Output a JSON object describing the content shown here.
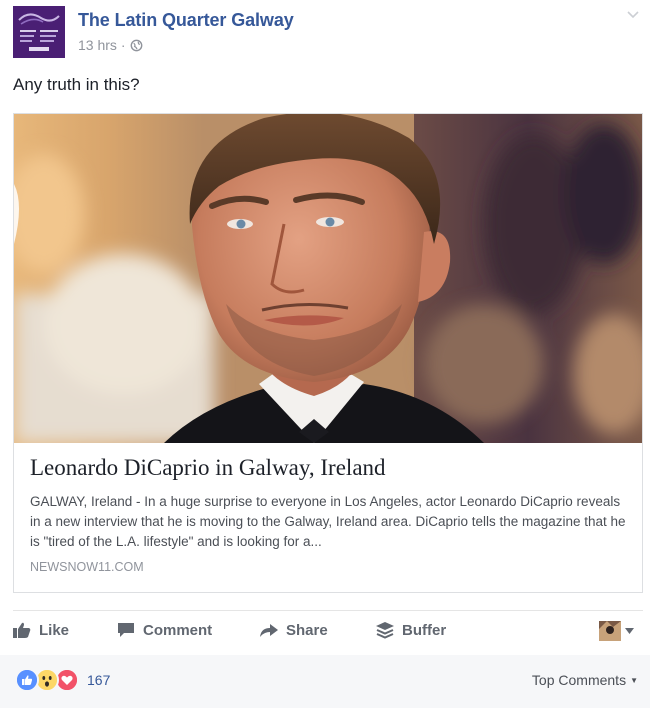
{
  "post": {
    "page_name": "The Latin Quarter Galway",
    "time": "13 hrs",
    "separator": "·",
    "privacy_icon": "globe-icon",
    "message": "Any truth in this?"
  },
  "link": {
    "title": "Leonardo DiCaprio in Galway, Ireland",
    "description": "GALWAY, Ireland - In a huge surprise to everyone in Los Angeles, actor Leonardo DiCaprio reveals in a new interview that he is moving to the Galway, Ireland area. DiCaprio tells the magazine that he is \"tired of the L.A. lifestyle\" and is looking for a...",
    "domain": "NEWSNOW11.COM"
  },
  "actions": {
    "like": "Like",
    "comment": "Comment",
    "share": "Share",
    "buffer": "Buffer"
  },
  "reactions": {
    "types": [
      "like",
      "wow",
      "love"
    ],
    "count": "167",
    "sort_label": "Top Comments",
    "sort_arrow": "▼"
  },
  "colors": {
    "link_blue": "#365899",
    "muted": "#90949c",
    "avatar_purple": "#4a1f74",
    "like_blue": "#5890ff",
    "love_red": "#f25268",
    "wow_yellow": "#fcd767"
  }
}
